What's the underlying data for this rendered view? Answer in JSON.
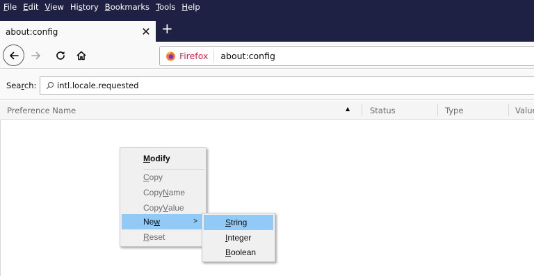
{
  "menubar": {
    "items": [
      {
        "pre": "",
        "acc": "F",
        "post": "ile"
      },
      {
        "pre": "",
        "acc": "E",
        "post": "dit"
      },
      {
        "pre": "",
        "acc": "V",
        "post": "iew"
      },
      {
        "pre": "Hi",
        "acc": "s",
        "post": "tory"
      },
      {
        "pre": "",
        "acc": "B",
        "post": "ookmarks"
      },
      {
        "pre": "",
        "acc": "T",
        "post": "ools"
      },
      {
        "pre": "",
        "acc": "H",
        "post": "elp"
      }
    ]
  },
  "tab": {
    "title": "about:config",
    "close_symbol": "✕",
    "new_tab_symbol": "+"
  },
  "navbar": {
    "back_icon": "back-arrow-icon",
    "forward_icon": "forward-arrow-icon",
    "reload_icon": "reload-icon",
    "home_icon": "home-icon",
    "identity_label": "Firefox",
    "url": "about:config",
    "brand_color": "#d7264c"
  },
  "search": {
    "label_pre": "Sea",
    "label_acc": "r",
    "label_post": "ch:",
    "value": "intl.locale.requested",
    "icon": "search-icon"
  },
  "columns": {
    "preference_name": "Preference Name",
    "status": "Status",
    "type": "Type",
    "value": "Value",
    "sort_indicator": "▲"
  },
  "context_menu": {
    "modify": {
      "pre": "",
      "acc": "M",
      "post": "odify"
    },
    "copy": {
      "pre": "",
      "acc": "C",
      "post": "opy"
    },
    "copy_name": {
      "pre": "Copy ",
      "acc": "N",
      "post": "ame"
    },
    "copy_value": {
      "pre": "Copy ",
      "acc": "V",
      "post": "alue"
    },
    "new": {
      "pre": "Ne",
      "acc": "w",
      "post": ""
    },
    "new_arrow": ">",
    "reset": {
      "pre": "",
      "acc": "R",
      "post": "eset"
    }
  },
  "submenu": {
    "string": {
      "pre": "",
      "acc": "S",
      "post": "tring"
    },
    "integer": {
      "pre": "",
      "acc": "I",
      "post": "nteger"
    },
    "boolean": {
      "pre": "",
      "acc": "B",
      "post": "oolean"
    }
  },
  "colors": {
    "titlebar": "#1e2144",
    "highlight": "#91c9f7",
    "menu_bg": "#f0f0f0"
  }
}
